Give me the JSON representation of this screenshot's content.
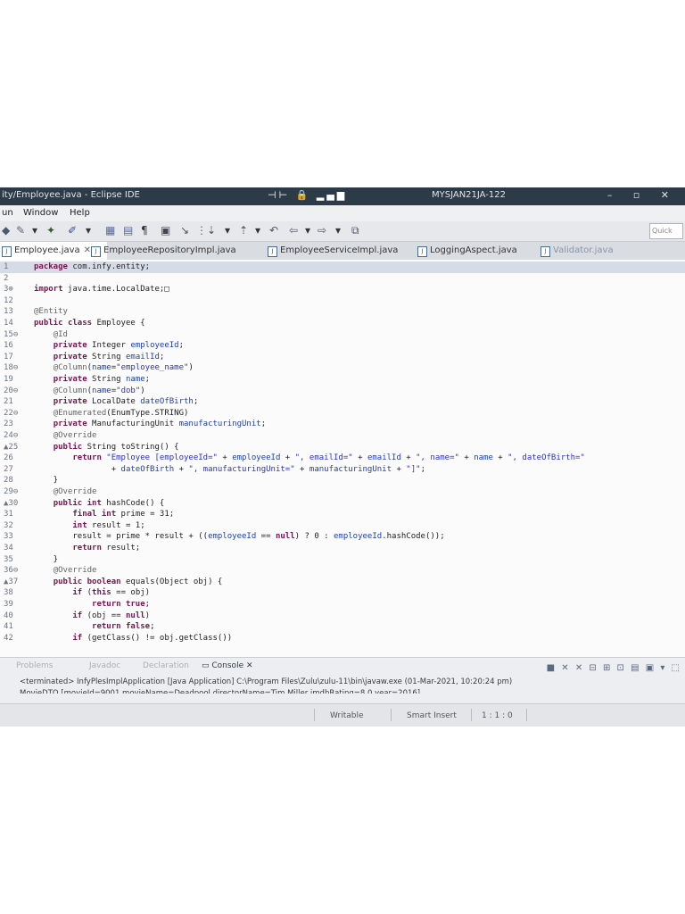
{
  "window": {
    "title": "ity/Employee.java - Eclipse IDE",
    "right_label": "MYSJAN21JA-122",
    "center_icons": "⊣⊢ 🔒 ▂▄▆",
    "controls": "– ▫ ✕"
  },
  "menu": [
    "un",
    "Window",
    "Help"
  ],
  "toolbar": {
    "quick_access": "Quick"
  },
  "tabs": [
    {
      "label": "Employee.java",
      "active": true,
      "close": "✕"
    },
    {
      "label": "EmployeeRepositoryImpl.java",
      "active": false
    },
    {
      "label": "EmployeeServiceImpl.java",
      "active": false
    },
    {
      "label": "LoggingAspect.java",
      "active": false
    },
    {
      "label": "Validator.java",
      "active": false
    }
  ],
  "code": [
    {
      "n": "1",
      "t": "package com.infy.entity;"
    },
    {
      "n": "2",
      "t": ""
    },
    {
      "n": "3⊕",
      "t": "import java.time.LocalDate;□"
    },
    {
      "n": "12",
      "t": ""
    },
    {
      "n": "13",
      "t": "@Entity"
    },
    {
      "n": "14",
      "t": "public class Employee {"
    },
    {
      "n": "15⊖",
      "t": "    @Id"
    },
    {
      "n": "16",
      "t": "    private Integer employeeId;"
    },
    {
      "n": "17",
      "t": "    private String emailId;"
    },
    {
      "n": "18⊖",
      "t": "    @Column(name=\"employee_name\")"
    },
    {
      "n": "19",
      "t": "    private String name;"
    },
    {
      "n": "20⊖",
      "t": "    @Column(name=\"dob\")"
    },
    {
      "n": "21",
      "t": "    private LocalDate dateOfBirth;"
    },
    {
      "n": "22⊖",
      "t": "    @Enumerated(EnumType.STRING)"
    },
    {
      "n": "23",
      "t": "    private ManufacturingUnit manufacturingUnit;"
    },
    {
      "n": "24⊖",
      "t": "    @Override"
    },
    {
      "n": "▲25",
      "t": "    public String toString() {"
    },
    {
      "n": "26",
      "t": "        return \"Employee [employeeId=\" + employeeId + \", emailId=\" + emailId + \", name=\" + name + \", dateOfBirth=\""
    },
    {
      "n": "27",
      "t": "                + dateOfBirth + \", manufacturingUnit=\" + manufacturingUnit + \"]\";"
    },
    {
      "n": "28",
      "t": "    }"
    },
    {
      "n": "29⊖",
      "t": "    @Override"
    },
    {
      "n": "▲30",
      "t": "    public int hashCode() {"
    },
    {
      "n": "31",
      "t": "        final int prime = 31;"
    },
    {
      "n": "32",
      "t": "        int result = 1;"
    },
    {
      "n": "33",
      "t": "        result = prime * result + ((employeeId == null) ? 0 : employeeId.hashCode());"
    },
    {
      "n": "34",
      "t": "        return result;"
    },
    {
      "n": "35",
      "t": "    }"
    },
    {
      "n": "36⊖",
      "t": "    @Override"
    },
    {
      "n": "▲37",
      "t": "    public boolean equals(Object obj) {"
    },
    {
      "n": "38",
      "t": "        if (this == obj)"
    },
    {
      "n": "39",
      "t": "            return true;"
    },
    {
      "n": "40",
      "t": "        if (obj == null)"
    },
    {
      "n": "41",
      "t": "            return false;"
    },
    {
      "n": "42",
      "t": "        if (getClass() != obj.getClass())"
    }
  ],
  "bottom_panel": {
    "tabs": [
      {
        "label": "Problems",
        "active": false
      },
      {
        "label": "Javadoc",
        "active": false
      },
      {
        "label": "Declaration",
        "active": false
      },
      {
        "label": "Console ✕",
        "active": true
      }
    ],
    "console_header": "<terminated> InfyPlesImplApplication [Java Application] C:\\Program Files\\Zulu\\zulu-11\\bin\\javaw.exe (01-Mar-2021, 10:20:24 pm)",
    "console_partial": "MovieDTO [movieId=9001  movieName=Deadpool  directorName=Tim Miller  imdbRating=8.0  year=2016]"
  },
  "status": {
    "writable": "Writable",
    "insert": "Smart Insert",
    "position": "1 : 1 : 0"
  }
}
